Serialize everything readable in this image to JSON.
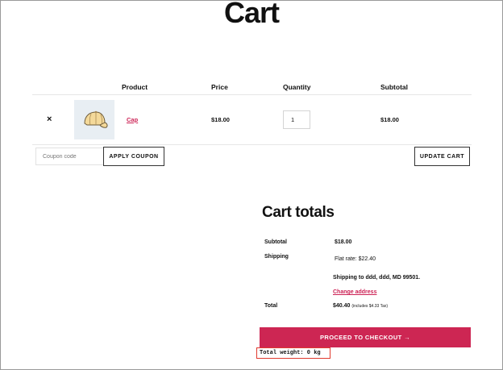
{
  "page": {
    "title": "Cart"
  },
  "cart_table": {
    "headers": {
      "product": "Product",
      "price": "Price",
      "quantity": "Quantity",
      "subtotal": "Subtotal"
    },
    "rows": [
      {
        "remove_label": "×",
        "product_name": "Cap",
        "price": "$18.00",
        "quantity": "1",
        "subtotal": "$18.00",
        "thumbnail_icon": "cap-icon"
      }
    ]
  },
  "actions": {
    "coupon_placeholder": "Coupon code",
    "apply_coupon_label": "APPLY COUPON",
    "update_cart_label": "UPDATE CART"
  },
  "totals": {
    "title": "Cart totals",
    "subtotal_label": "Subtotal",
    "subtotal_value": "$18.00",
    "shipping_label": "Shipping",
    "shipping_method": "Flat rate: $22.40",
    "shipping_to_prefix": "Shipping to",
    "shipping_to_address": "ddd, ddd, MD 99501.",
    "change_address_label": "Change address",
    "total_label": "Total",
    "total_value": "$40.40",
    "tax_note": "(includes $4.33 Tax)"
  },
  "checkout": {
    "label": "PROCEED TO CHECKOUT →"
  },
  "weight": {
    "text": "Total weight: 0 kg"
  },
  "colors": {
    "accent": "#cd2653",
    "link": "#cc2255",
    "highlight_border": "#e03a2e"
  }
}
